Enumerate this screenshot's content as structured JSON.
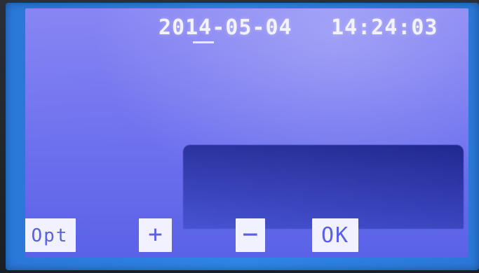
{
  "status_bar": {
    "date": "2014-05-04",
    "time": "14:24:03"
  },
  "softkeys": {
    "opt": "Opt",
    "plus": "+",
    "minus": "−",
    "ok": "OK"
  },
  "colors": {
    "bezel": "#2f86e6",
    "screen_top": "#7f7cf2",
    "screen_bottom": "#5a62e6",
    "softkey_bg": "#f1f1ff",
    "softkey_text": "#5860e5",
    "text": "#f3f3ff"
  }
}
